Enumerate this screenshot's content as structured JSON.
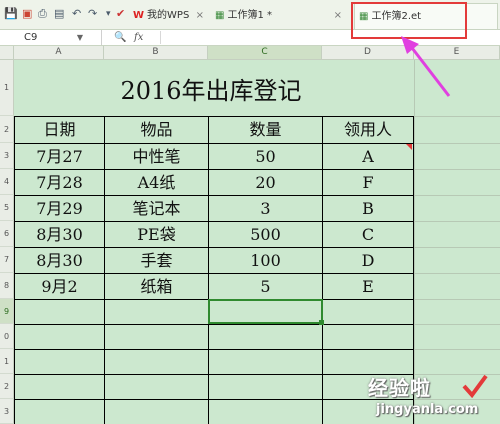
{
  "tabs": [
    {
      "label": "我的WPS",
      "close": "×"
    },
    {
      "label": "工作簿1 *",
      "close": "×"
    },
    {
      "label": "工作簿2.et",
      "close": ""
    }
  ],
  "formula_bar": {
    "cell_ref": "C9",
    "fx": "fx",
    "value": ""
  },
  "columns": [
    "A",
    "B",
    "C",
    "D",
    "E"
  ],
  "rows": [
    "1",
    "2",
    "3",
    "4",
    "5",
    "6",
    "7",
    "8",
    "9",
    "0",
    "1",
    "2",
    "3"
  ],
  "sheet": {
    "title": "2016年出库登记",
    "headers": [
      "日期",
      "物品",
      "数量",
      "领用人"
    ],
    "records": [
      [
        "7月27",
        "中性笔",
        "50",
        "A"
      ],
      [
        "7月28",
        "A4纸",
        "20",
        "F"
      ],
      [
        "7月29",
        "笔记本",
        "3",
        "B"
      ],
      [
        "8月30",
        "PE袋",
        "500",
        "C"
      ],
      [
        "8月30",
        "手套",
        "100",
        "D"
      ],
      [
        "9月2",
        "纸箱",
        "5",
        "E"
      ]
    ]
  },
  "watermark": {
    "line1": "经验啦",
    "line2": "jingyanla.com"
  },
  "colors": {
    "sheet_bg": "#cce8cf",
    "highlight": "#e33a3a",
    "arrow": "#e040e0",
    "selection": "#2f8a2f"
  }
}
